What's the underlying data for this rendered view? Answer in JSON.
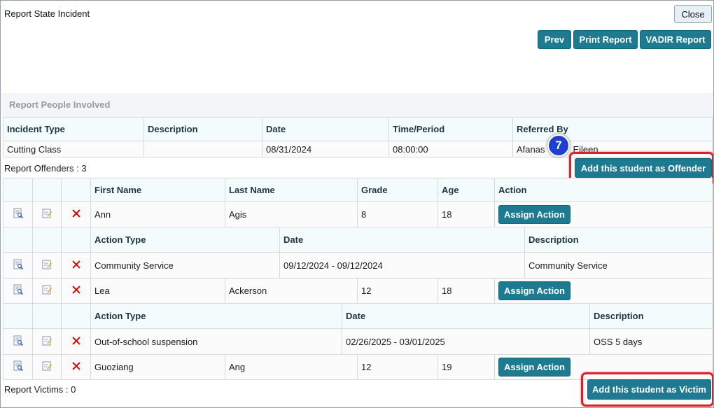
{
  "window": {
    "title": "Report State Incident",
    "close_label": "Close"
  },
  "toolbar": {
    "prev_label": "Prev",
    "print_label": "Print Report",
    "vadir_label": "VADIR Report"
  },
  "section": {
    "label": "Report People Involved"
  },
  "incident": {
    "headers": [
      "Incident Type",
      "Description",
      "Date",
      "Time/Period",
      "Referred By"
    ],
    "row": {
      "incident_type": "Cutting Class",
      "description": "",
      "date": "08/31/2024",
      "time": "08:00:00",
      "referred_first": "Afanas",
      "referred_last": "Eileen"
    }
  },
  "offenders": {
    "label": "Report Offenders : 3",
    "add_label": "Add this student as Offender",
    "headers": [
      "First Name",
      "Last Name",
      "Grade",
      "Age",
      "Action"
    ],
    "assign_label": "Assign Action",
    "action_headers": [
      "Action Type",
      "Date",
      "Description"
    ],
    "rows": [
      {
        "first": "Ann",
        "last": "Agis",
        "grade": "8",
        "age": "18",
        "action": {
          "type": "Community Service",
          "date": "09/12/2024 - 09/12/2024",
          "description": "Community Service"
        }
      },
      {
        "first": "Lea",
        "last": "Ackerson",
        "grade": "12",
        "age": "18",
        "action": {
          "type": "Out-of-school suspension",
          "date": "02/26/2025 - 03/01/2025",
          "description": "OSS 5 days"
        }
      },
      {
        "first": "Guoziang",
        "last": "Ang",
        "grade": "12",
        "age": "19"
      }
    ]
  },
  "victims": {
    "label": "Report Victims : 0",
    "add_label": "Add this student as Victim"
  },
  "callout": {
    "step": "7"
  },
  "icons": {
    "view": "view-document-icon",
    "edit": "edit-note-icon",
    "delete": "delete-x-icon"
  },
  "colors": {
    "button": "#1e7a90",
    "highlight": "#d8212a",
    "badge": "#1f3fd1",
    "header_bg": "#f4fbfd"
  }
}
